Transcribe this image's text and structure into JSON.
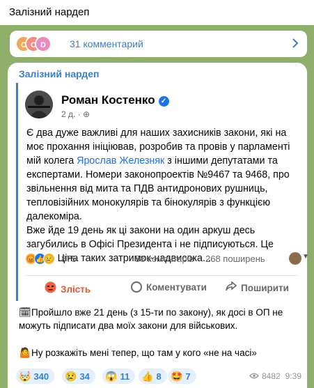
{
  "header": {
    "title": "Залізний нардеп"
  },
  "comments_bar": {
    "avatars": [
      {
        "letter": "C",
        "color": "#f2a65a"
      },
      {
        "letter": "C",
        "color": "#f28b82"
      },
      {
        "letter": "D",
        "color": "#e88cc0"
      }
    ],
    "label": "31 комментарий",
    "chevron": "chevron-right-icon"
  },
  "message": {
    "channel": "Залізний нардеп",
    "post": {
      "author": "Роман Костенко",
      "verified_icon": "✓",
      "time": "2 д. ·",
      "globe_icon": "⊕",
      "text": {
        "p1_a": "Є два дуже важливі для наших захисників закони, які на моє прохання ініціював, розробив та провів у парламенті мій колега ",
        "p1_link": "Ярослав Железняк",
        "p1_b": " з іншими депутатами та експертами. Номери законопроектів №9467 та 9468, про звільнення від мита та ПДВ антидронових рушниць, тепловізійних монокулярів та бінокулярів з функцією далекоміра.",
        "p2": "Вже йде 19 день як ці закони на один аркуш десь загубились в Офісі Президента і не підписуються. Це довго. Ціна таких затримок-надвисока..."
      },
      "stats": {
        "reaction_icons": [
          "😡",
          "👍",
          "😢"
        ],
        "reactions": "875",
        "comments": "58 коментарів",
        "shares": "268 поширень"
      },
      "actions": {
        "angry": "Злість",
        "comment": "Коментувати",
        "share": "Поширити"
      }
    },
    "lines": [
      {
        "emoji": "🗓",
        "text": "Пройшло вже 21 день (з 15-ти по закону), як досі в ОП не можуть підписати два моїх закони для військових."
      },
      {
        "emoji": "🤷",
        "text": "Ну розкажіть мені тепер, що там у кого «не на часі»"
      }
    ],
    "reactions": [
      {
        "emoji": "🤯",
        "count": "340"
      },
      {
        "emoji": "😢",
        "count": "34"
      },
      {
        "emoji": "😱",
        "count": "11"
      },
      {
        "emoji": "👍",
        "count": "8"
      },
      {
        "emoji": "🤩",
        "count": "7"
      }
    ],
    "views": "8482",
    "time": "9:39"
  }
}
